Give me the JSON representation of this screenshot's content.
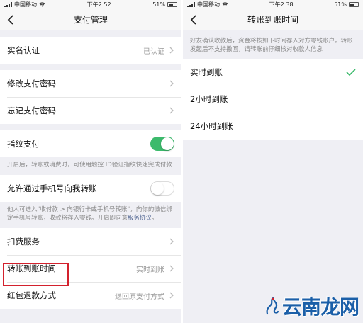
{
  "left": {
    "status": {
      "carrier": "中国移动",
      "time": "下午2:52",
      "battery": "51%"
    },
    "nav_title": "支付管理",
    "rows": {
      "realname": {
        "label": "实名认证",
        "value": "已认证"
      },
      "modify_pwd": {
        "label": "修改支付密码"
      },
      "forgot_pwd": {
        "label": "忘记支付密码"
      },
      "fingerprint": {
        "label": "指纹支付",
        "state": "on"
      },
      "phone_transfer": {
        "label": "允许通过手机号向我转账",
        "state": "off"
      },
      "deduction": {
        "label": "扣费服务"
      },
      "arrival_time": {
        "label": "转账到账时间",
        "value": "实时到账"
      },
      "refund": {
        "label": "红包退款方式",
        "value": "退回原支付方式"
      }
    },
    "notes": {
      "fingerprint": "开启后，转账或消费时，可使用触控 ID验证指纹快速完成付款",
      "phone_transfer": "他人可进入\"收付款 > 向银行卡或手机号转账\"，向你的微信绑定手机号转账，收款将存入零钱。开启即同意",
      "phone_transfer_link": "服务协议",
      "phone_transfer_end": "。"
    }
  },
  "right": {
    "status": {
      "carrier": "中国移动",
      "time": "下午2:38",
      "battery": "51%"
    },
    "nav_title": "转账到账时间",
    "description": "好友确认收款后，资金将按如下时间存入对方零钱账户。转账发起后不支持撤回，请转账前仔细核对收款人信息",
    "options": [
      {
        "label": "实时到账",
        "selected": true
      },
      {
        "label": "2小时到账",
        "selected": false
      },
      {
        "label": "24小时到账",
        "selected": false
      }
    ]
  },
  "watermark": {
    "text": "云南龙网"
  },
  "colors": {
    "accent_green": "#3cba6c",
    "highlight_red": "#d3212d",
    "link": "#576b95"
  }
}
